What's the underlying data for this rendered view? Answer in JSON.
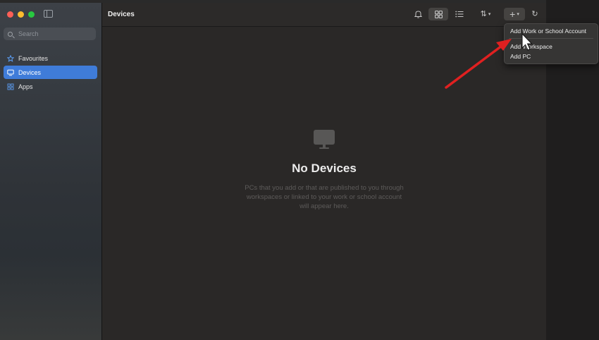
{
  "sidebar": {
    "search_placeholder": "Search",
    "items": [
      {
        "label": "Favourites",
        "icon": "star-icon"
      },
      {
        "label": "Devices",
        "icon": "monitor-icon",
        "active": true
      },
      {
        "label": "Apps",
        "icon": "apps-grid-icon"
      }
    ]
  },
  "header": {
    "title": "Devices",
    "toolbar_icons": [
      "bell-icon",
      "grid-view-icon",
      "list-view-icon",
      "sort-icon",
      "add-icon",
      "chevron-down-icon",
      "refresh-icon"
    ]
  },
  "empty_state": {
    "icon": "monitor-icon",
    "title": "No Devices",
    "description_lines": [
      "PCs that you add or that are published to you through",
      "workspaces or linked to your work or school account",
      "will appear here."
    ]
  },
  "add_menu": {
    "items": [
      {
        "label": "Add Work or School Account"
      },
      {
        "label": "Add Workspace"
      },
      {
        "label": "Add PC"
      }
    ]
  },
  "colors": {
    "accent": "#3f7cd9",
    "annotation_arrow": "#e02020"
  }
}
